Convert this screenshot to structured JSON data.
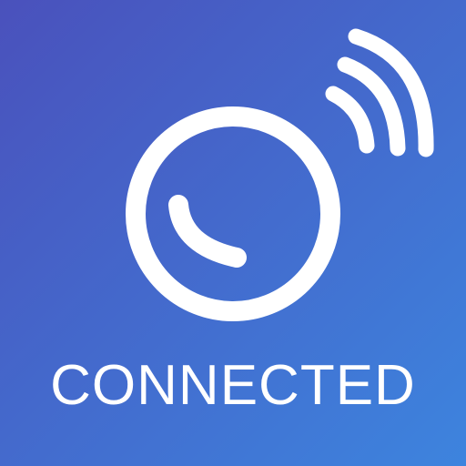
{
  "label": "CONNECTED",
  "colors": {
    "background_top_left": "#4a51bc",
    "background_bottom_right": "#3d84de",
    "foreground": "#ffffff"
  },
  "icons": {
    "ring": "ring-icon",
    "handset": "phone-handset-icon",
    "signal": "signal-waves-icon"
  }
}
